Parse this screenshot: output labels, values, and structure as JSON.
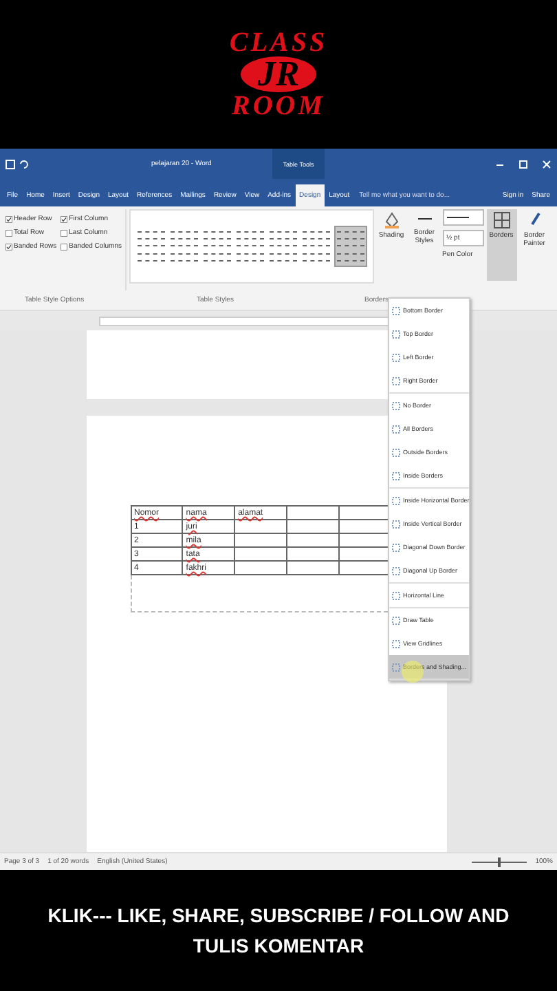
{
  "logo": {
    "line_1": "CLASS",
    "line_2": "JR",
    "line_3": "ROOM"
  },
  "title_bar": {
    "title": "pelajaran 20 - Word",
    "context": "Table Tools"
  },
  "tabs": [
    {
      "label": "File",
      "selected": false
    },
    {
      "label": "Home",
      "selected": false
    },
    {
      "label": "Insert",
      "selected": false
    },
    {
      "label": "Design",
      "selected": false
    },
    {
      "label": "Layout",
      "selected": false
    },
    {
      "label": "References",
      "selected": false
    },
    {
      "label": "Mailings",
      "selected": false
    },
    {
      "label": "Review",
      "selected": false
    },
    {
      "label": "View",
      "selected": false
    },
    {
      "label": "Add-ins",
      "selected": false
    },
    {
      "label": "Design",
      "selected": true
    },
    {
      "label": "Layout",
      "selected": false
    }
  ],
  "tell_me": "Tell me what you want to do...",
  "sign_in": "Sign in",
  "share": "Share",
  "style_options": [
    {
      "label": "Header Row",
      "checked": true
    },
    {
      "label": "First Column",
      "checked": true
    },
    {
      "label": "Total Row",
      "checked": false
    },
    {
      "label": "Last Column",
      "checked": false
    },
    {
      "label": "Banded Rows",
      "checked": true
    },
    {
      "label": "Banded Columns",
      "checked": false
    }
  ],
  "table_styles": [
    {
      "selected": false
    },
    {
      "selected": false
    },
    {
      "selected": false
    },
    {
      "selected": false
    },
    {
      "selected": false
    },
    {
      "selected": false
    },
    {
      "selected": true
    }
  ],
  "shading": "Shading",
  "border_styles": "Border Styles",
  "pen_weight": "½ pt",
  "pen_color": "Pen Color",
  "borders": "Borders",
  "border_painter": "Border Painter",
  "group_labels": [
    "Table Style Options",
    "Table Styles",
    "Borders"
  ],
  "border_menu": [
    {
      "items": [
        {
          "label": "Bottom Border",
          "selected": false
        },
        {
          "label": "Top Border",
          "selected": false
        },
        {
          "label": "Left Border",
          "selected": false
        },
        {
          "label": "Right Border",
          "selected": false
        }
      ]
    },
    {
      "items": [
        {
          "label": "No Border",
          "selected": false
        },
        {
          "label": "All Borders",
          "selected": false
        },
        {
          "label": "Outside Borders",
          "selected": false
        },
        {
          "label": "Inside Borders",
          "selected": false
        }
      ]
    },
    {
      "items": [
        {
          "label": "Inside Horizontal Border",
          "selected": false
        },
        {
          "label": "Inside Vertical Border",
          "selected": false
        },
        {
          "label": "Diagonal Down Border",
          "selected": false
        },
        {
          "label": "Diagonal Up Border",
          "selected": false
        }
      ]
    },
    {
      "items": [
        {
          "label": "Horizontal Line",
          "selected": false
        }
      ]
    },
    {
      "items": [
        {
          "label": "Draw Table",
          "selected": false
        },
        {
          "label": "View Gridlines",
          "selected": false
        },
        {
          "label": "Borders and Shading...",
          "selected": true
        }
      ]
    }
  ],
  "table": {
    "rows": [
      [
        "Nomor",
        "nama",
        "alamat"
      ],
      [
        "1",
        "juri"
      ],
      [
        "2",
        "mila"
      ],
      [
        "3",
        "tata"
      ],
      [
        "4",
        "fakhri"
      ]
    ]
  },
  "status_bar": {
    "page": "Page 3 of 3",
    "words": "1 of 20 words",
    "language": "English (United States)",
    "zoom": "100%",
    "zoom_slider": {
      "level": 0.5
    }
  },
  "caption": "KLIK--- LIKE, SHARE, SUBSCRIBE / FOLLOW AND TULIS KOMENTAR"
}
